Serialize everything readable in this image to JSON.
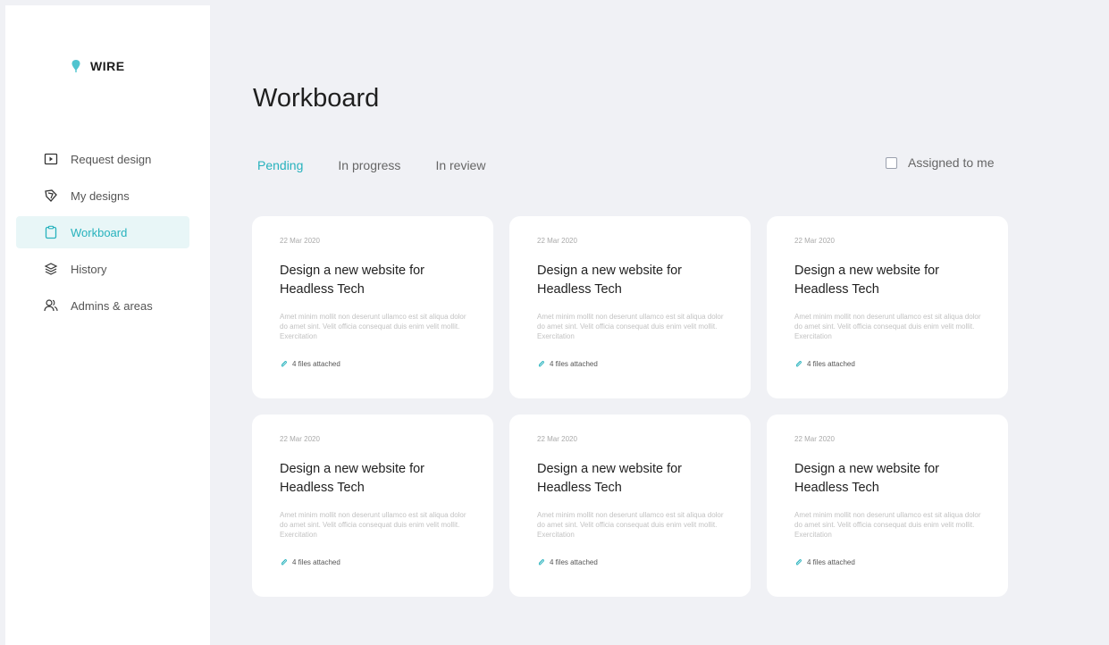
{
  "app": {
    "logo_text": "WIRE"
  },
  "sidebar": {
    "items": [
      {
        "label": "Request design",
        "icon": "folder-plus-icon",
        "active": false
      },
      {
        "label": "My designs",
        "icon": "layers-icon",
        "active": false
      },
      {
        "label": "Workboard",
        "icon": "clipboard-icon",
        "active": true
      },
      {
        "label": "History",
        "icon": "stack-icon",
        "active": false
      },
      {
        "label": "Admins & areas",
        "icon": "users-icon",
        "active": false
      }
    ]
  },
  "main": {
    "title": "Workboard",
    "tabs": [
      {
        "label": "Pending",
        "active": true
      },
      {
        "label": "In progress",
        "active": false
      },
      {
        "label": "In review",
        "active": false
      }
    ],
    "assigned_label": "Assigned to me",
    "cards": [
      {
        "date": "22 Mar 2020",
        "title": "Design a new website for Headless Tech",
        "description": "Amet minim mollit non deserunt ullamco est sit aliqua dolor do amet sint. Velit officia consequat duis enim velit mollit. Exercitation",
        "attachments": "4 files attached"
      },
      {
        "date": "22 Mar 2020",
        "title": "Design a new website for Headless Tech",
        "description": "Amet minim mollit non deserunt ullamco est sit aliqua dolor do amet sint. Velit officia consequat duis enim velit mollit. Exercitation",
        "attachments": "4 files attached"
      },
      {
        "date": "22 Mar 2020",
        "title": "Design a new website for Headless Tech",
        "description": "Amet minim mollit non deserunt ullamco est sit aliqua dolor do amet sint. Velit officia consequat duis enim velit mollit. Exercitation",
        "attachments": "4 files attached"
      },
      {
        "date": "22 Mar 2020",
        "title": "Design a new website for Headless Tech",
        "description": "Amet minim mollit non deserunt ullamco est sit aliqua dolor do amet sint. Velit officia consequat duis enim velit mollit. Exercitation",
        "attachments": "4 files attached"
      },
      {
        "date": "22 Mar 2020",
        "title": "Design a new website for Headless Tech",
        "description": "Amet minim mollit non deserunt ullamco est sit aliqua dolor do amet sint. Velit officia consequat duis enim velit mollit. Exercitation",
        "attachments": "4 files attached"
      },
      {
        "date": "22 Mar 2020",
        "title": "Design a new website for Headless Tech",
        "description": "Amet minim mollit non deserunt ullamco est sit aliqua dolor do amet sint. Velit officia consequat duis enim velit mollit. Exercitation",
        "attachments": "4 files attached"
      }
    ]
  },
  "colors": {
    "accent": "#27b2bd",
    "background": "#f0f1f5",
    "active_nav_bg": "#e8f6f7"
  }
}
